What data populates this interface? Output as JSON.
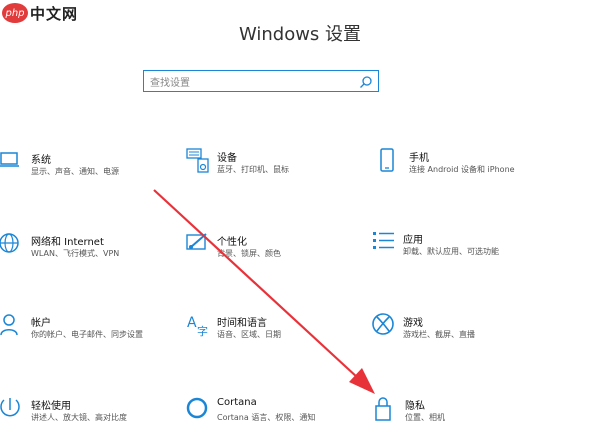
{
  "watermark": {
    "badge": "php",
    "text": "中文网"
  },
  "window": {
    "title": "Windows 设置"
  },
  "search": {
    "placeholder": "查找设置"
  },
  "colors": {
    "accent": "#1b86d6",
    "arrow": "#e8323a"
  },
  "tiles": [
    {
      "name": "系统",
      "desc": "显示、声音、通知、电源",
      "icon": "laptop-icon"
    },
    {
      "name": "设备",
      "desc": "蓝牙、打印机、鼠标",
      "icon": "keyboard-printer-icon"
    },
    {
      "name": "手机",
      "desc": "连接 Android 设备和 iPhone",
      "icon": "phone-icon"
    },
    {
      "name": "网络和 Internet",
      "desc": "WLAN、飞行模式、VPN",
      "icon": "globe-icon"
    },
    {
      "name": "个性化",
      "desc": "背景、锁屏、颜色",
      "icon": "brush-icon"
    },
    {
      "name": "应用",
      "desc": "卸载、默认应用、可选功能",
      "icon": "apps-list-icon"
    },
    {
      "name": "帐户",
      "desc": "你的帐户、电子邮件、同步设置",
      "icon": "person-icon"
    },
    {
      "name": "时间和语言",
      "desc": "语音、区域、日期",
      "icon": "time-language-icon"
    },
    {
      "name": "游戏",
      "desc": "游戏栏、截屏、直播",
      "icon": "xbox-icon"
    },
    {
      "name": "轻松使用",
      "desc": "讲述人、放大镜、高对比度",
      "icon": "accessibility-icon"
    },
    {
      "name": "Cortana",
      "desc": "Cortana 语言、权限、通知",
      "icon": "cortana-circle-icon"
    },
    {
      "name": "隐私",
      "desc": "位置、相机",
      "icon": "lock-icon"
    }
  ]
}
